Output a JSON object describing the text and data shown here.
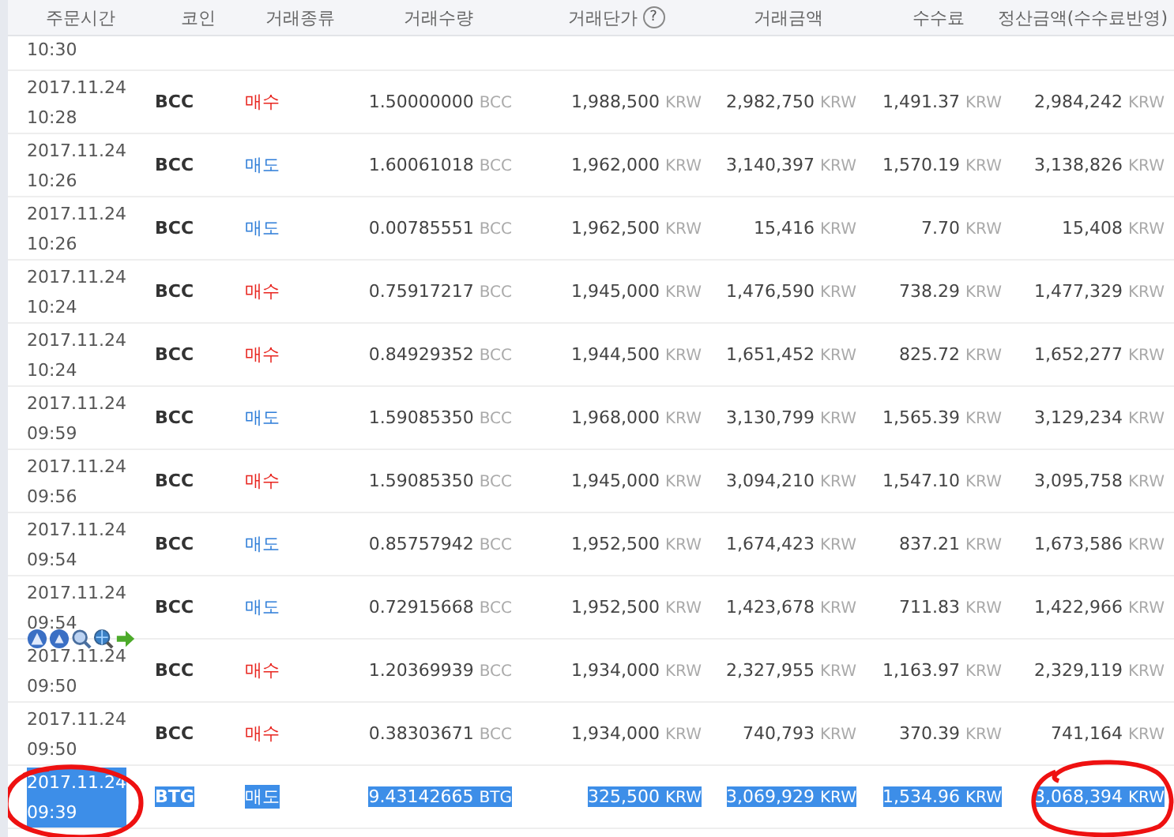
{
  "columns": [
    {
      "label": "주문시간"
    },
    {
      "label": "코인"
    },
    {
      "label": "거래종류"
    },
    {
      "label": "거래수량"
    },
    {
      "label": "거래단가",
      "help_icon": "?"
    },
    {
      "label": "거래금액"
    },
    {
      "label": "수수료"
    },
    {
      "label": "정산금액(수수료반영)"
    }
  ],
  "partial_row": {
    "time": "10:30"
  },
  "rows": [
    {
      "date": "2017.11.24",
      "time": "10:28",
      "coin": "BCC",
      "type": "매수",
      "kind": "buy",
      "qty": "1.50000000",
      "qty_unit": "BCC",
      "price": "1,988,500",
      "price_unit": "KRW",
      "amount": "2,982,750",
      "amount_unit": "KRW",
      "fee": "1,491.37",
      "fee_unit": "KRW",
      "settle": "2,984,242",
      "settle_unit": "KRW",
      "selected": false,
      "circled": false
    },
    {
      "date": "2017.11.24",
      "time": "10:26",
      "coin": "BCC",
      "type": "매도",
      "kind": "sell",
      "qty": "1.60061018",
      "qty_unit": "BCC",
      "price": "1,962,000",
      "price_unit": "KRW",
      "amount": "3,140,397",
      "amount_unit": "KRW",
      "fee": "1,570.19",
      "fee_unit": "KRW",
      "settle": "3,138,826",
      "settle_unit": "KRW",
      "selected": false,
      "circled": false
    },
    {
      "date": "2017.11.24",
      "time": "10:26",
      "coin": "BCC",
      "type": "매도",
      "kind": "sell",
      "qty": "0.00785551",
      "qty_unit": "BCC",
      "price": "1,962,500",
      "price_unit": "KRW",
      "amount": "15,416",
      "amount_unit": "KRW",
      "fee": "7.70",
      "fee_unit": "KRW",
      "settle": "15,408",
      "settle_unit": "KRW",
      "selected": false,
      "circled": false
    },
    {
      "date": "2017.11.24",
      "time": "10:24",
      "coin": "BCC",
      "type": "매수",
      "kind": "buy",
      "qty": "0.75917217",
      "qty_unit": "BCC",
      "price": "1,945,000",
      "price_unit": "KRW",
      "amount": "1,476,590",
      "amount_unit": "KRW",
      "fee": "738.29",
      "fee_unit": "KRW",
      "settle": "1,477,329",
      "settle_unit": "KRW",
      "selected": false,
      "circled": false
    },
    {
      "date": "2017.11.24",
      "time": "10:24",
      "coin": "BCC",
      "type": "매수",
      "kind": "buy",
      "qty": "0.84929352",
      "qty_unit": "BCC",
      "price": "1,944,500",
      "price_unit": "KRW",
      "amount": "1,651,452",
      "amount_unit": "KRW",
      "fee": "825.72",
      "fee_unit": "KRW",
      "settle": "1,652,277",
      "settle_unit": "KRW",
      "selected": false,
      "circled": false
    },
    {
      "date": "2017.11.24",
      "time": "09:59",
      "coin": "BCC",
      "type": "매도",
      "kind": "sell",
      "qty": "1.59085350",
      "qty_unit": "BCC",
      "price": "1,968,000",
      "price_unit": "KRW",
      "amount": "3,130,799",
      "amount_unit": "KRW",
      "fee": "1,565.39",
      "fee_unit": "KRW",
      "settle": "3,129,234",
      "settle_unit": "KRW",
      "selected": false,
      "circled": false
    },
    {
      "date": "2017.11.24",
      "time": "09:56",
      "coin": "BCC",
      "type": "매수",
      "kind": "buy",
      "qty": "1.59085350",
      "qty_unit": "BCC",
      "price": "1,945,000",
      "price_unit": "KRW",
      "amount": "3,094,210",
      "amount_unit": "KRW",
      "fee": "1,547.10",
      "fee_unit": "KRW",
      "settle": "3,095,758",
      "settle_unit": "KRW",
      "selected": false,
      "circled": false
    },
    {
      "date": "2017.11.24",
      "time": "09:54",
      "coin": "BCC",
      "type": "매도",
      "kind": "sell",
      "qty": "0.85757942",
      "qty_unit": "BCC",
      "price": "1,952,500",
      "price_unit": "KRW",
      "amount": "1,674,423",
      "amount_unit": "KRW",
      "fee": "837.21",
      "fee_unit": "KRW",
      "settle": "1,673,586",
      "settle_unit": "KRW",
      "selected": false,
      "circled": false
    },
    {
      "date": "2017.11.24",
      "time": "09:54",
      "coin": "BCC",
      "type": "매도",
      "kind": "sell",
      "qty": "0.72915668",
      "qty_unit": "BCC",
      "price": "1,952,500",
      "price_unit": "KRW",
      "amount": "1,423,678",
      "amount_unit": "KRW",
      "fee": "711.83",
      "fee_unit": "KRW",
      "settle": "1,422,966",
      "settle_unit": "KRW",
      "selected": false,
      "circled": false,
      "toolbar": true
    },
    {
      "date": "2017.11.24",
      "time": "09:50",
      "coin": "BCC",
      "type": "매수",
      "kind": "buy",
      "qty": "1.20369939",
      "qty_unit": "BCC",
      "price": "1,934,000",
      "price_unit": "KRW",
      "amount": "2,327,955",
      "amount_unit": "KRW",
      "fee": "1,163.97",
      "fee_unit": "KRW",
      "settle": "2,329,119",
      "settle_unit": "KRW",
      "selected": false,
      "circled": false
    },
    {
      "date": "2017.11.24",
      "time": "09:50",
      "coin": "BCC",
      "type": "매수",
      "kind": "buy",
      "qty": "0.38303671",
      "qty_unit": "BCC",
      "price": "1,934,000",
      "price_unit": "KRW",
      "amount": "740,793",
      "amount_unit": "KRW",
      "fee": "370.39",
      "fee_unit": "KRW",
      "settle": "741,164",
      "settle_unit": "KRW",
      "selected": false,
      "circled": false
    },
    {
      "date": "2017.11.24",
      "time": "09:39",
      "coin": "BTG",
      "type": "매도",
      "kind": "sell",
      "qty": "9.43142665",
      "qty_unit": "BTG",
      "price": "325,500",
      "price_unit": "KRW",
      "amount": "3,069,929",
      "amount_unit": "KRW",
      "fee": "1,534.96",
      "fee_unit": "KRW",
      "settle": "3,068,394",
      "settle_unit": "KRW",
      "selected": true,
      "circled": true
    }
  ]
}
